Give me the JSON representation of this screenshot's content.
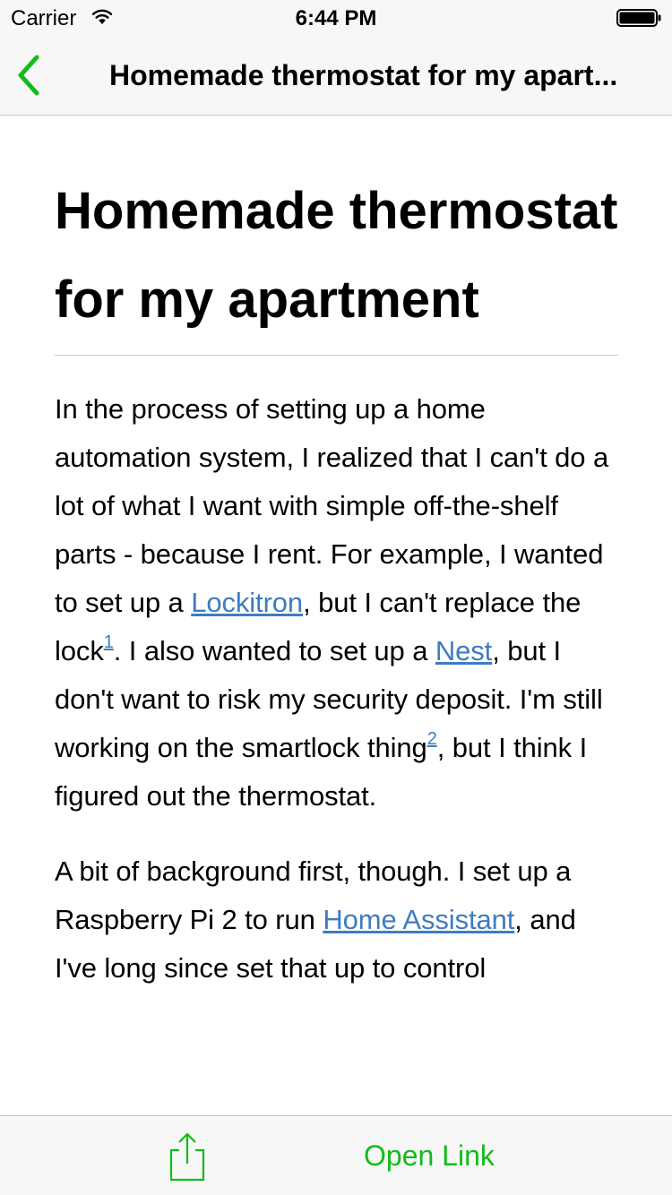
{
  "status_bar": {
    "carrier": "Carrier",
    "time": "6:44 PM"
  },
  "nav": {
    "title": "Homemade thermostat for my apart...",
    "accent_color": "#13bb1a"
  },
  "article": {
    "title": "Homemade thermostat for my apartment",
    "p1": {
      "t1": "In the process of setting up a home automation system, I realized that I can't do a lot of what I want with simple off-the-shelf parts - because I rent. For example, I wanted to set up a ",
      "link1": "Lockitron",
      "t2": ", but I can't replace the lock",
      "fn1": "1",
      "t3": ". I also wanted to set up a ",
      "link2": "Nest",
      "t4": ", but I don't want to risk my security deposit. I'm still working on the smartlock thing",
      "fn2": "2",
      "t5": ", but I think I figured out the thermostat."
    },
    "p2": {
      "t1": "A bit of background first, though. I set up a Raspberry Pi 2 to run ",
      "link1": "Home Assistant",
      "t2": ", and I've long since set that up to control"
    },
    "link_color": "#3e7cc1"
  },
  "toolbar": {
    "share_icon": "share-icon",
    "open_link_label": "Open Link"
  }
}
